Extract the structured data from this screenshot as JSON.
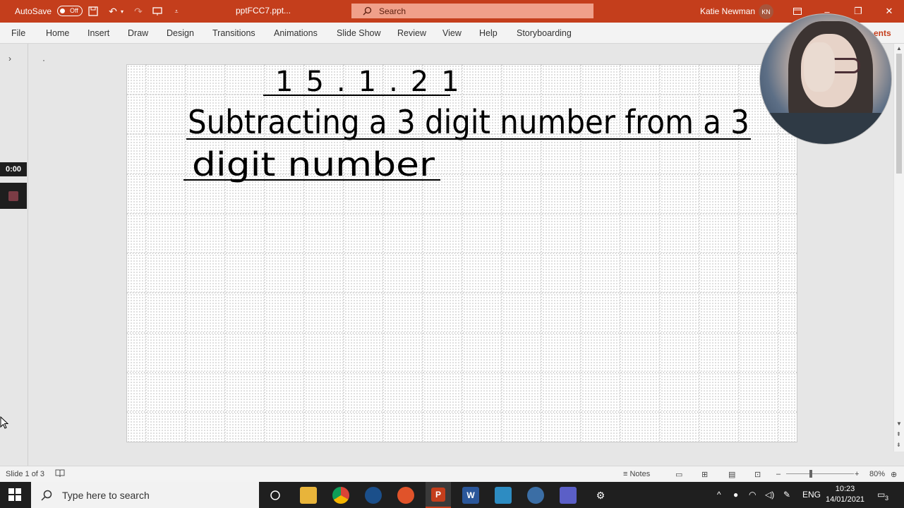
{
  "titlebar": {
    "autosave_label": "AutoSave",
    "autosave_state": "Off",
    "document_title": "pptFCC7.ppt...",
    "search_placeholder": "Search",
    "user_name": "Katie Newman",
    "user_initials": "KN"
  },
  "ribbon": {
    "tabs": [
      "File",
      "Home",
      "Insert",
      "Draw",
      "Design",
      "Transitions",
      "Animations",
      "Slide Show",
      "Review",
      "View",
      "Help",
      "Storyboarding"
    ],
    "partial_tab": "ents"
  },
  "recording": {
    "time": "0:00"
  },
  "slide": {
    "date_line": "15.1.21",
    "title_line1": "Subtracting a 3 digit number from a 3",
    "title_line2": "digit number"
  },
  "statusbar": {
    "slide_info": "Slide 1 of 3",
    "notes_label": "Notes",
    "zoom": "80%"
  },
  "taskbar": {
    "search_placeholder": "Type here to search",
    "language": "ENG",
    "time": "10:23",
    "date": "14/01/2021",
    "notification_count": "3"
  }
}
